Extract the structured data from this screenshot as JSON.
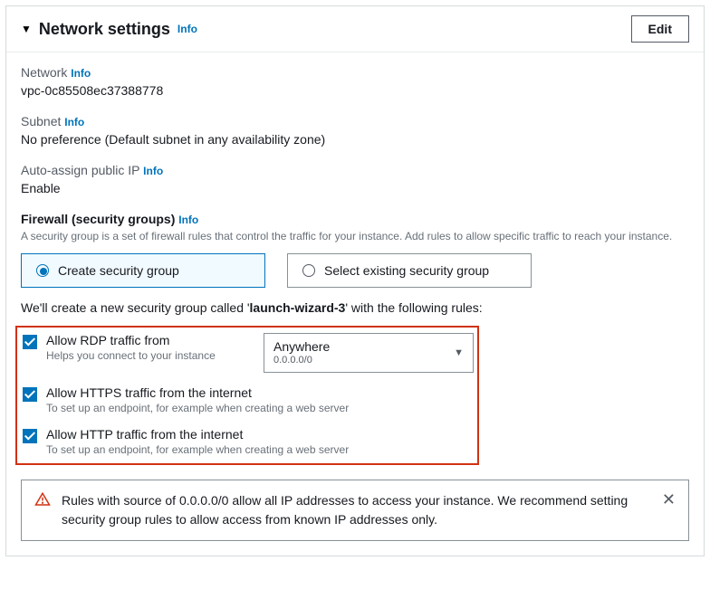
{
  "header": {
    "title": "Network settings",
    "info": "Info",
    "edit": "Edit"
  },
  "network": {
    "label": "Network",
    "info": "Info",
    "value": "vpc-0c85508ec37388778"
  },
  "subnet": {
    "label": "Subnet",
    "info": "Info",
    "value": "No preference (Default subnet in any availability zone)"
  },
  "auto_ip": {
    "label": "Auto-assign public IP",
    "info": "Info",
    "value": "Enable"
  },
  "firewall": {
    "label": "Firewall (security groups)",
    "info": "Info",
    "helper": "A security group is a set of firewall rules that control the traffic for your instance. Add rules to allow specific traffic to reach your instance.",
    "create_label": "Create security group",
    "select_label": "Select existing security group",
    "note_prefix": "We'll create a new security group called '",
    "note_name": "launch-wizard-3",
    "note_suffix": "' with the following rules:"
  },
  "rules": {
    "rdp": {
      "label": "Allow RDP traffic from",
      "helper": "Helps you connect to your instance",
      "select_main": "Anywhere",
      "select_sub": "0.0.0.0/0"
    },
    "https": {
      "label": "Allow HTTPS traffic from the internet",
      "helper": "To set up an endpoint, for example when creating a web server"
    },
    "http": {
      "label": "Allow HTTP traffic from the internet",
      "helper": "To set up an endpoint, for example when creating a web server"
    }
  },
  "alert": {
    "text": "Rules with source of 0.0.0.0/0 allow all IP addresses to access your instance. We recommend setting security group rules to allow access from known IP addresses only."
  }
}
